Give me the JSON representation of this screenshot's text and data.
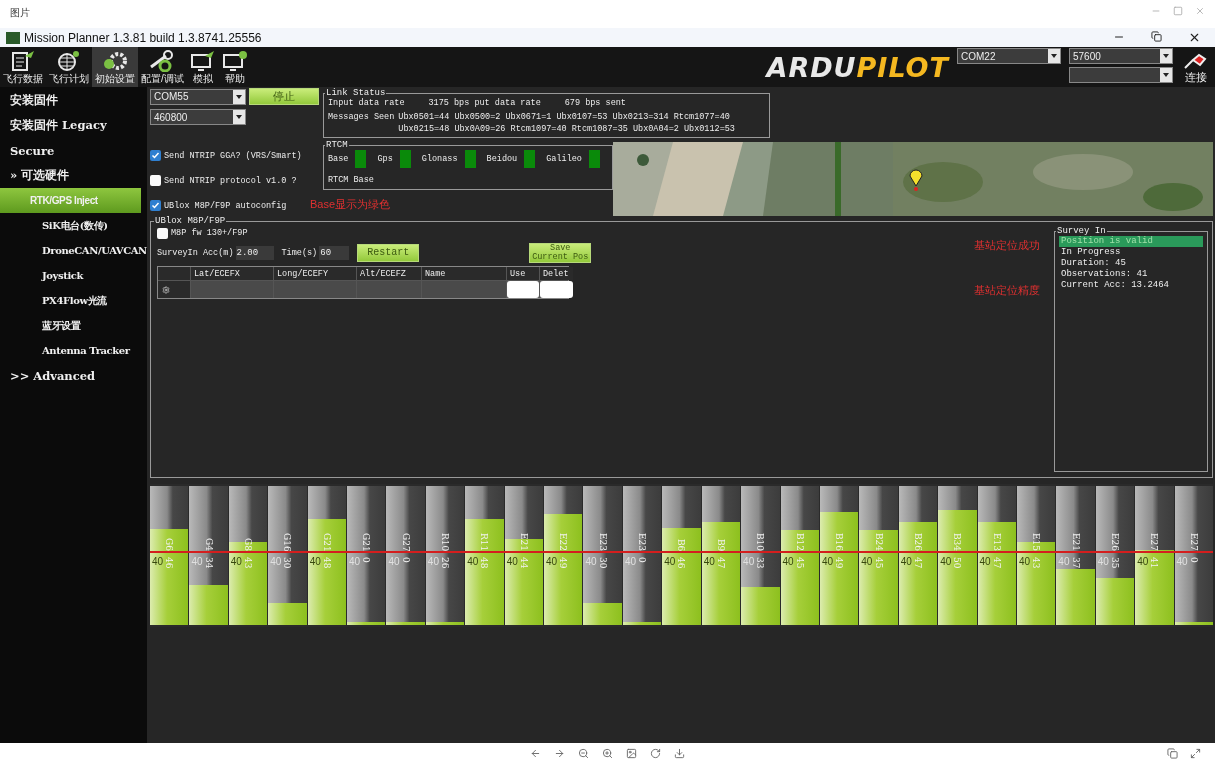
{
  "viewer": {
    "title": "图片"
  },
  "window": {
    "title": "Mission Planner 1.3.81 build 1.3.8741.25556"
  },
  "toolbar": [
    {
      "label": "飞行数据",
      "selected": false,
      "kind": "data"
    },
    {
      "label": "飞行计划",
      "selected": false,
      "kind": "plan"
    },
    {
      "label": "初始设置",
      "selected": true,
      "kind": "setup"
    },
    {
      "label": "配置/调试",
      "selected": false,
      "kind": "config"
    },
    {
      "label": "模拟",
      "selected": false,
      "kind": "sim"
    },
    {
      "label": "帮助",
      "selected": false,
      "kind": "help"
    }
  ],
  "logo": [
    "ARDU",
    "PILOT"
  ],
  "connection": {
    "port": "COM22",
    "baud": "57600",
    "connect": "连接"
  },
  "sidebar": [
    {
      "label": "安装固件",
      "kind": "top",
      "selected": false
    },
    {
      "label": "安装固件 Legacy",
      "kind": "top",
      "selected": false
    },
    {
      "label": "Secure",
      "kind": "top",
      "selected": false
    },
    {
      "label": "» 可选硬件",
      "kind": "top",
      "selected": false
    },
    {
      "label": "RTK/GPS Inject",
      "kind": "sub",
      "selected": true
    },
    {
      "label": "SiK电台(数传)",
      "kind": "sub",
      "selected": false
    },
    {
      "label": "DroneCAN/UAVCAN",
      "kind": "sub",
      "selected": false
    },
    {
      "label": "Joystick",
      "kind": "sub",
      "selected": false
    },
    {
      "label": "PX4Flow光流",
      "kind": "sub",
      "selected": false
    },
    {
      "label": "蓝牙设置",
      "kind": "sub",
      "selected": false
    },
    {
      "label": "Antenna Tracker",
      "kind": "sub",
      "selected": false
    },
    {
      "label": ">> Advanced",
      "kind": "top",
      "selected": false
    }
  ],
  "inject": {
    "port": "COM55",
    "baud": "460800",
    "stop": "停止",
    "options": [
      {
        "label": "Send NTRIP GGA? (VRS/Smart)",
        "checked": true
      },
      {
        "label": "Send NTRIP protocol v1.0 ?",
        "checked": false
      },
      {
        "label": "UBlox M8P/F9P autoconfig",
        "checked": true
      }
    ]
  },
  "link_status": {
    "title": "Link Status",
    "rows": [
      {
        "kind": "rate",
        "label": "Input data rate",
        "values": [
          "3175 bps put data rate",
          "679 bps sent"
        ]
      },
      {
        "kind": "messages",
        "label": "Messages Seen",
        "values": [
          "Ubx0501=44 Ubx0500=2 Ubx0671=1 Ubx0107=53 Ubx0213=314 Rtcm1077=40",
          "Ubx0215=48 Ubx0A09=26 Rtcm1097=40 Rtcm1087=35 Ubx0A04=2 Ubx0112=53"
        ]
      }
    ]
  },
  "rtcm": {
    "title": "RTCM",
    "indicators": [
      {
        "label": "Base",
        "on": true
      },
      {
        "label": "Gps",
        "on": true
      },
      {
        "label": "Glonass",
        "on": true
      },
      {
        "label": "Beidou",
        "on": true
      },
      {
        "label": "Galileo",
        "on": true
      }
    ],
    "footer": "RTCM Base"
  },
  "annotations": {
    "base": "Base显示为绿色",
    "valid": "基站定位成功",
    "accuracy": "基站定位精度"
  },
  "ublox": {
    "title": "UBlox M8P/F9P",
    "option": {
      "label": "M8P fw 130+/F9P",
      "checked": false
    },
    "acc_label": "SurveyIn Acc(m)",
    "acc_value": "2.00",
    "time_label": "Time(s)",
    "time_value": "60",
    "restart": "Restart",
    "save": [
      "Save",
      "Current Pos"
    ],
    "columns": [
      "Lat/ECEFX",
      "Long/ECEFY",
      "Alt/ECEFZ",
      "Name",
      "Use",
      "Delet"
    ]
  },
  "survey_in": {
    "title": "Survey In",
    "lines": [
      {
        "text": "Position is valid",
        "highlighted": true
      },
      {
        "text": "In Progress",
        "highlighted": false
      },
      {
        "text": "Duration: 45",
        "highlighted": false
      },
      {
        "text": "Observations: 41",
        "highlighted": false
      },
      {
        "text": "Current Acc: 13.2464",
        "highlighted": false
      }
    ]
  },
  "signal": {
    "bars": [
      {
        "label": "G6",
        "value": "46",
        "reference": "40",
        "level": 0.69
      },
      {
        "label": "G4",
        "value": "34",
        "reference": "40",
        "level": 0.29
      },
      {
        "label": "G8",
        "value": "43",
        "reference": "40",
        "level": 0.6
      },
      {
        "label": "G16",
        "value": "30",
        "reference": "40",
        "level": 0.16
      },
      {
        "label": "G21",
        "value": "48",
        "reference": "40",
        "level": 0.76
      },
      {
        "label": "G21",
        "value": "0",
        "reference": "40",
        "level": 0.02
      },
      {
        "label": "G27",
        "value": "0",
        "reference": "40",
        "level": 0.02
      },
      {
        "label": "R10",
        "value": "26",
        "reference": "40",
        "level": 0.02
      },
      {
        "label": "R11",
        "value": "48",
        "reference": "40",
        "level": 0.76
      },
      {
        "label": "E21",
        "value": "44",
        "reference": "40",
        "level": 0.62
      },
      {
        "label": "E22",
        "value": "49",
        "reference": "40",
        "level": 0.8
      },
      {
        "label": "E23",
        "value": "30",
        "reference": "40",
        "level": 0.16
      },
      {
        "label": "E23",
        "value": "0",
        "reference": "40",
        "level": 0.02
      },
      {
        "label": "B6",
        "value": "46",
        "reference": "40",
        "level": 0.7
      },
      {
        "label": "B9",
        "value": "47",
        "reference": "40",
        "level": 0.74
      },
      {
        "label": "B10",
        "value": "33",
        "reference": "40",
        "level": 0.27
      },
      {
        "label": "B12",
        "value": "45",
        "reference": "40",
        "level": 0.68
      },
      {
        "label": "B16",
        "value": "49",
        "reference": "40",
        "level": 0.81
      },
      {
        "label": "B24",
        "value": "45",
        "reference": "40",
        "level": 0.68
      },
      {
        "label": "B26",
        "value": "47",
        "reference": "40",
        "level": 0.74
      },
      {
        "label": "B34",
        "value": "50",
        "reference": "40",
        "level": 0.83
      },
      {
        "label": "E13",
        "value": "47",
        "reference": "40",
        "level": 0.74
      },
      {
        "label": "E15",
        "value": "43",
        "reference": "40",
        "level": 0.6
      },
      {
        "label": "E21",
        "value": "37",
        "reference": "40",
        "level": 0.4
      },
      {
        "label": "E26",
        "value": "35",
        "reference": "40",
        "level": 0.34
      },
      {
        "label": "E27",
        "value": "41",
        "reference": "40",
        "level": 0.54
      },
      {
        "label": "E27",
        "value": "0",
        "reference": "40",
        "level": 0.02
      }
    ]
  }
}
